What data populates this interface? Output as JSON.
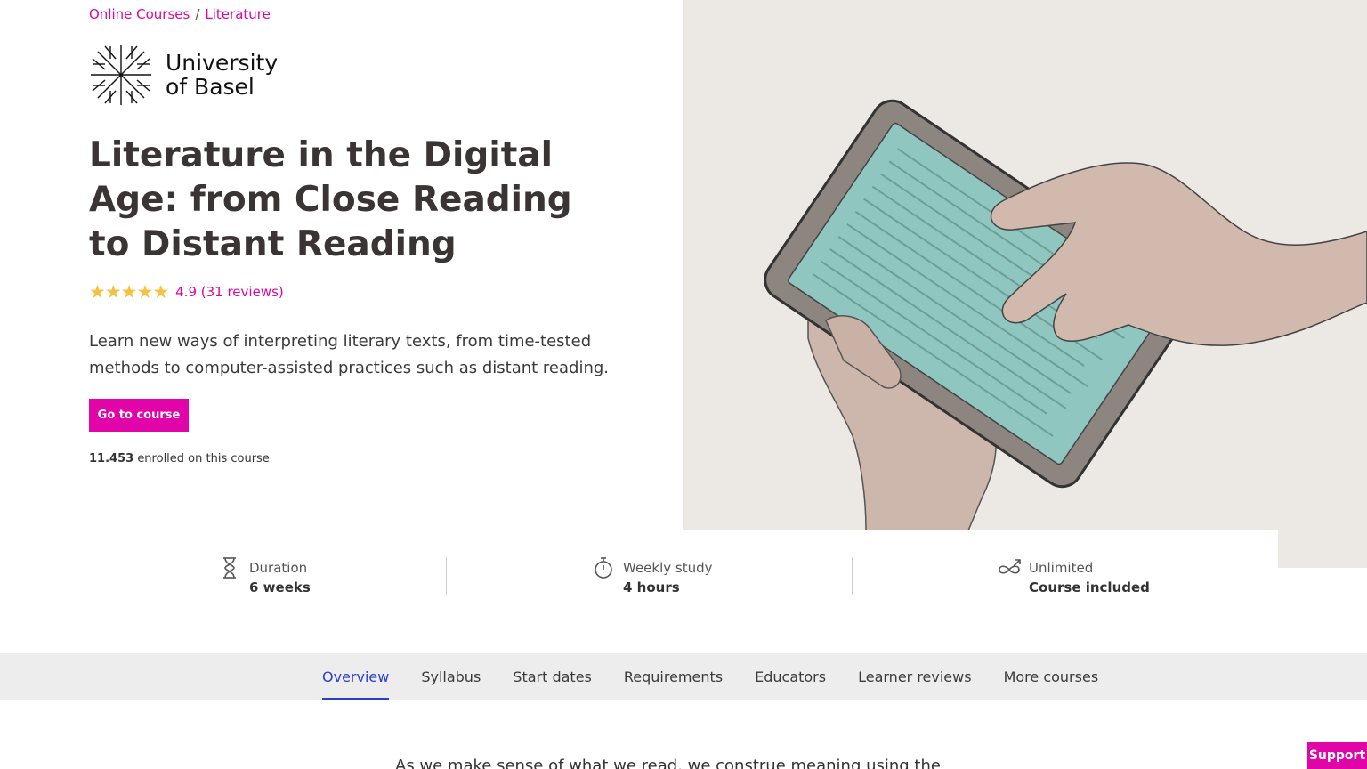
{
  "breadcrumb": {
    "items": [
      "Online Courses",
      "Literature"
    ],
    "separator": "/"
  },
  "logo": {
    "line1": "University",
    "line2": "of Basel"
  },
  "course": {
    "title": "Literature in the Digital Age: from Close Reading to Distant Reading",
    "rating_text": "4.9 (31 reviews)",
    "stars": 5,
    "description": "Learn new ways of interpreting literary texts, from time-tested methods to computer-assisted practices such as distant reading.",
    "cta_label": "Go to course",
    "enrolled_count": "11.453",
    "enrolled_suffix": "enrolled on this course"
  },
  "stats": [
    {
      "icon": "hourglass-icon",
      "label": "Duration",
      "value": "6 weeks"
    },
    {
      "icon": "stopwatch-icon",
      "label": "Weekly study",
      "value": "4 hours"
    },
    {
      "icon": "infinity-icon",
      "label": "Unlimited",
      "value": "Course included"
    }
  ],
  "tabs": [
    {
      "label": "Overview",
      "active": true
    },
    {
      "label": "Syllabus"
    },
    {
      "label": "Start dates"
    },
    {
      "label": "Requirements"
    },
    {
      "label": "Educators"
    },
    {
      "label": "Learner reviews"
    },
    {
      "label": "More courses"
    }
  ],
  "body_text": "As we make sense of what we read, we construe meaning using the",
  "support_label": "Support",
  "colors": {
    "accent": "#e104a8",
    "tab_active": "#2c3ecb",
    "star": "#f6c143",
    "hero_bg": "#ece8e3",
    "screen": "#8fc6bf"
  }
}
